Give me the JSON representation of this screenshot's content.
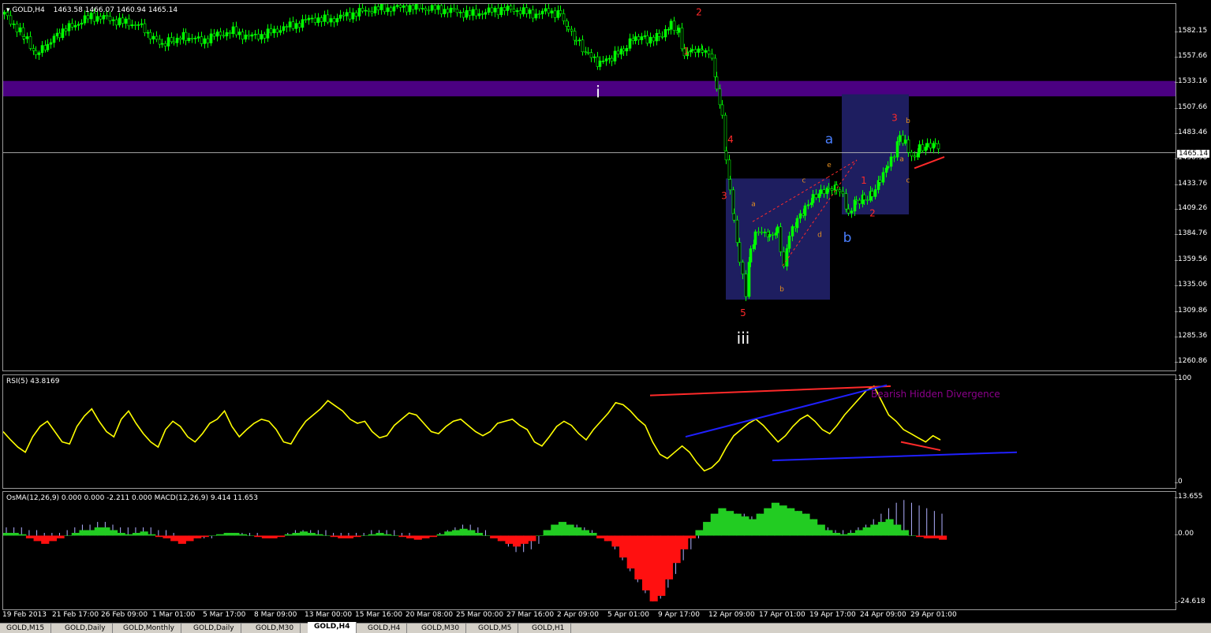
{
  "chart_data": [
    {
      "type": "candlestick",
      "title": "GOLD,H4",
      "ohlc_header": "1463.58 1466.07 1460.94 1465.14",
      "current_price_tag": "1465.14",
      "y_ticks": [
        "1582.15",
        "1557.66",
        "1533.16",
        "1507.66",
        "1483.46",
        "1458.96",
        "1433.76",
        "1409.26",
        "1384.76",
        "1359.56",
        "1335.06",
        "1309.86",
        "1285.36",
        "1260.86"
      ],
      "ylim": [
        1253,
        1610
      ],
      "x_ticks": [
        "19 Feb 2013",
        "21 Feb 17:00",
        "26 Feb 09:00",
        "1 Mar 01:00",
        "5 Mar 17:00",
        "8 Mar 09:00",
        "13 Mar 00:00",
        "15 Mar 16:00",
        "20 Mar 08:00",
        "25 Mar 00:00",
        "27 Mar 16:00",
        "2 Apr 09:00",
        "5 Apr 01:00",
        "9 Apr 17:00",
        "12 Apr 09:00",
        "17 Apr 01:00",
        "19 Apr 17:00",
        "24 Apr 09:00",
        "29 Apr 01:00"
      ],
      "close_path": [
        [
          0,
          1600
        ],
        [
          12,
          1590
        ],
        [
          25,
          1578
        ],
        [
          40,
          1560
        ],
        [
          55,
          1570
        ],
        [
          70,
          1582
        ],
        [
          90,
          1590
        ],
        [
          110,
          1598
        ],
        [
          130,
          1596
        ],
        [
          150,
          1592
        ],
        [
          170,
          1590
        ],
        [
          185,
          1578
        ],
        [
          200,
          1570
        ],
        [
          215,
          1575
        ],
        [
          230,
          1578
        ],
        [
          250,
          1574
        ],
        [
          270,
          1580
        ],
        [
          290,
          1583
        ],
        [
          310,
          1578
        ],
        [
          330,
          1580
        ],
        [
          350,
          1586
        ],
        [
          370,
          1590
        ],
        [
          390,
          1596
        ],
        [
          410,
          1594
        ],
        [
          430,
          1598
        ],
        [
          450,
          1602
        ],
        [
          470,
          1605
        ],
        [
          490,
          1606
        ],
        [
          510,
          1607
        ],
        [
          530,
          1606
        ],
        [
          550,
          1605
        ],
        [
          570,
          1603
        ],
        [
          590,
          1600
        ],
        [
          610,
          1602
        ],
        [
          630,
          1605
        ],
        [
          650,
          1604
        ],
        [
          670,
          1600
        ],
        [
          690,
          1603
        ],
        [
          705,
          1600
        ],
        [
          715,
          1586
        ],
        [
          725,
          1575
        ],
        [
          740,
          1560
        ],
        [
          755,
          1552
        ],
        [
          770,
          1558
        ],
        [
          785,
          1565
        ],
        [
          800,
          1578
        ],
        [
          815,
          1576
        ],
        [
          830,
          1578
        ],
        [
          845,
          1590
        ],
        [
          855,
          1582
        ],
        [
          862,
          1560
        ],
        [
          872,
          1565
        ],
        [
          885,
          1563
        ],
        [
          897,
          1560
        ],
        [
          903,
          1528
        ],
        [
          910,
          1500
        ],
        [
          915,
          1460
        ],
        [
          920,
          1430
        ],
        [
          925,
          1400
        ],
        [
          932,
          1360
        ],
        [
          940,
          1330
        ],
        [
          946,
          1370
        ],
        [
          952,
          1385
        ],
        [
          960,
          1390
        ],
        [
          970,
          1385
        ],
        [
          980,
          1390
        ],
        [
          988,
          1355
        ],
        [
          995,
          1385
        ],
        [
          1005,
          1400
        ],
        [
          1015,
          1410
        ],
        [
          1025,
          1420
        ],
        [
          1035,
          1425
        ],
        [
          1045,
          1428
        ],
        [
          1055,
          1430
        ],
        [
          1063,
          1422
        ],
        [
          1070,
          1405
        ],
        [
          1080,
          1418
        ],
        [
          1090,
          1420
        ],
        [
          1100,
          1425
        ],
        [
          1110,
          1440
        ],
        [
          1120,
          1455
        ],
        [
          1128,
          1465
        ],
        [
          1135,
          1480
        ],
        [
          1142,
          1475
        ],
        [
          1150,
          1458
        ],
        [
          1160,
          1468
        ],
        [
          1170,
          1470
        ],
        [
          1180,
          1472
        ],
        [
          1188,
          1465
        ]
      ],
      "annotations": [
        {
          "text": "i",
          "color": "#ffffff"
        },
        {
          "text": "iii",
          "color": "#ffffff"
        },
        {
          "text": "1",
          "color": "#ff2a2a"
        },
        {
          "text": "2",
          "color": "#ff2a2a"
        },
        {
          "text": "4",
          "color": "#ff2a2a"
        },
        {
          "text": "3",
          "color": "#ff2a2a"
        },
        {
          "text": "5",
          "color": "#ff2a2a"
        },
        {
          "text": "a",
          "color": "#4a7fff"
        },
        {
          "text": "b",
          "color": "#4a7fff"
        },
        {
          "text": "a",
          "color": "#e69020"
        },
        {
          "text": "b",
          "color": "#e69020"
        },
        {
          "text": "c",
          "color": "#e69020"
        },
        {
          "text": "d",
          "color": "#e69020"
        },
        {
          "text": "e",
          "color": "#e69020"
        },
        {
          "text": "1",
          "color": "#ff2a2a"
        },
        {
          "text": "2",
          "color": "#ff2a2a"
        },
        {
          "text": "3",
          "color": "#ff2a2a"
        },
        {
          "text": "b",
          "color": "#e69020"
        },
        {
          "text": "a",
          "color": "#e69020"
        },
        {
          "text": "c",
          "color": "#e69020"
        }
      ],
      "resistance_zone": [
        1520,
        1535
      ],
      "colors": {
        "candle": "#00ff00",
        "zone": "#4b0082",
        "box": "#1e1e60"
      }
    },
    {
      "type": "line",
      "title": "RSI(5) 43.8169",
      "y_ticks": [
        "100",
        "0"
      ],
      "ylim": [
        0,
        100
      ],
      "series": [
        {
          "values": [
            50,
            42,
            35,
            30,
            45,
            55,
            60,
            50,
            40,
            38,
            55,
            65,
            72,
            60,
            50,
            45,
            62,
            70,
            58,
            48,
            40,
            35,
            52,
            60,
            55,
            45,
            40,
            48,
            58,
            62,
            70,
            55,
            45,
            52,
            58,
            62,
            60,
            52,
            40,
            38,
            50,
            60,
            66,
            72,
            80,
            75,
            70,
            62,
            58,
            60,
            50,
            44,
            46,
            56,
            62,
            68,
            66,
            58,
            50,
            48,
            55,
            60,
            62,
            56,
            50,
            46,
            50,
            58,
            60,
            62,
            56,
            52,
            40,
            36,
            45,
            55,
            60,
            56,
            48,
            42,
            52,
            60,
            68,
            78,
            76,
            70,
            62,
            56,
            40,
            28,
            24,
            30,
            36,
            30,
            20,
            12,
            15,
            22,
            35,
            46,
            52,
            58,
            62,
            56,
            48,
            40,
            46,
            55,
            62,
            66,
            60,
            52,
            48,
            56,
            66,
            74,
            82,
            90,
            94,
            80,
            66,
            60,
            52,
            48,
            44,
            40,
            46,
            42
          ]
        }
      ],
      "annotation_text": "Bearish Hidden Divergence",
      "colors": {
        "line": "#ffff00"
      }
    },
    {
      "type": "bar",
      "title": "OsMA(12,26,9) 0.000 0.000 -2.211 0.000  MACD(12,26,9) 9.414 11.653",
      "y_ticks": [
        "13.655",
        "0.00",
        "-24.618"
      ],
      "ylim": [
        -24.618,
        13.655
      ],
      "series": [
        {
          "name": "OsMA",
          "values": [
            1,
            1,
            0.5,
            -1,
            -2,
            -3,
            -2,
            -1,
            0,
            1,
            2,
            2,
            3,
            3,
            2,
            1,
            0.5,
            1,
            1.5,
            0.5,
            -0.5,
            -1,
            -2,
            -3,
            -2,
            -1,
            -0.5,
            0,
            0.5,
            1,
            1,
            0.5,
            0,
            -0.5,
            -1,
            -1,
            -0.5,
            0.5,
            1,
            1.5,
            1,
            0.5,
            0,
            -0.5,
            -1,
            -1,
            -0.5,
            0,
            0.5,
            1,
            0.5,
            0,
            -0.5,
            -1,
            -1.5,
            -1,
            -0.5,
            0.5,
            1.5,
            2,
            2.5,
            2,
            1,
            0,
            -1,
            -2,
            -3,
            -4,
            -3,
            -2,
            0,
            2,
            4,
            5,
            4,
            3,
            2,
            1,
            -1,
            -2,
            -4,
            -8,
            -12,
            -16,
            -20,
            -24,
            -22,
            -16,
            -10,
            -5,
            -1,
            2,
            5,
            8,
            10,
            9,
            8,
            7,
            6,
            8,
            10,
            12,
            11,
            10,
            9,
            8,
            6,
            4,
            2,
            1,
            0.5,
            1,
            2,
            3,
            4,
            5,
            6,
            4,
            2,
            0,
            -0.5,
            -1,
            -1,
            -1.5
          ]
        },
        {
          "name": "MACD",
          "values": [
            3,
            3,
            3,
            2,
            2,
            1,
            1,
            1,
            2,
            3,
            4,
            4,
            5,
            5,
            4,
            3,
            3,
            3,
            3,
            3,
            2,
            2,
            1,
            0,
            -1,
            -1,
            -1,
            -1,
            0,
            1,
            1,
            1,
            1,
            1,
            0,
            0,
            0,
            1,
            2,
            2,
            2,
            2,
            2,
            1,
            1,
            1,
            1,
            1,
            2,
            2,
            2,
            2,
            1,
            1,
            0,
            0,
            0,
            1,
            2,
            3,
            4,
            4,
            3,
            2,
            0,
            -2,
            -4,
            -6,
            -6,
            -5,
            -3,
            0,
            2,
            4,
            4,
            4,
            3,
            2,
            0,
            -2,
            -5,
            -9,
            -13,
            -17,
            -21,
            -24,
            -23,
            -19,
            -14,
            -9,
            -5,
            -1,
            2,
            5,
            7,
            8,
            8,
            8,
            7,
            8,
            9,
            10,
            10,
            10,
            9,
            8,
            6,
            4,
            3,
            2,
            2,
            2,
            3,
            4,
            6,
            8,
            10,
            12,
            13,
            12,
            11,
            10,
            9,
            8
          ]
        }
      ],
      "colors": {
        "pos": "#22cc22",
        "neg": "#ff1010",
        "macd": "#b0b0ff"
      }
    }
  ],
  "tabs": [
    "GOLD,M15",
    "GOLD,Daily",
    "GOLD,Monthly",
    "GOLD,Daily",
    "GOLD,M30",
    "GOLD,H4",
    "GOLD,H4",
    "GOLD,M30",
    "GOLD,M5",
    "GOLD,H1"
  ],
  "active_tab_index": 5
}
